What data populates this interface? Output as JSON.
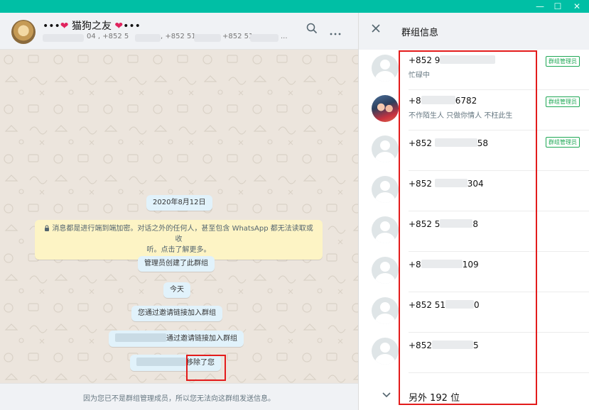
{
  "window": {
    "minimize": "—",
    "maximize": "☐",
    "close": "✕"
  },
  "chat": {
    "title_left": "•••",
    "heart": "❤",
    "title_name": "猫狗之友",
    "title_right": "•••",
    "subtitle_parts": [
      "04 , +852 5",
      ", +852 51",
      "+852 51",
      "..."
    ],
    "date_chip": "2020年8月12日",
    "encryption_notice_line1": "消息都是进行端到端加密。对话之外的任何人，甚至包含 WhatsApp 都无法读取或收",
    "encryption_notice_line2": "听。点击了解更多。",
    "admin_created": "管理员创建了此群组",
    "today_chip": "今天",
    "joined_via_link": "您通过邀请链接加入群组",
    "other_joined": "通过邀请链接加入群组",
    "removed_prefix": "",
    "removed_you": "移除了您",
    "footer_notice": "因为您已不是群组管理成员，所以您无法向这群组发送信息。"
  },
  "info": {
    "title": "群组信息",
    "admin_badge": "群组管理员",
    "members": [
      {
        "phone_prefix": "+852 9",
        "phone_suffix": "",
        "status": "忙碌中",
        "admin": true,
        "photo": false
      },
      {
        "phone_prefix": "+8",
        "phone_suffix": "6782",
        "status": "不作陌生人 只做你情人 不枉此生",
        "admin": true,
        "photo": true
      },
      {
        "phone_prefix": "+852 ",
        "phone_suffix": "58",
        "status": "",
        "admin": true,
        "photo": false
      },
      {
        "phone_prefix": "+852 ",
        "phone_suffix": "304",
        "status": "",
        "admin": false,
        "photo": false
      },
      {
        "phone_prefix": "+852 5",
        "phone_suffix": "8",
        "status": "",
        "admin": false,
        "photo": false
      },
      {
        "phone_prefix": "+8",
        "phone_suffix": "109",
        "status": "",
        "admin": false,
        "photo": false
      },
      {
        "phone_prefix": "+852 51",
        "phone_suffix": "0",
        "status": "",
        "admin": false,
        "photo": false
      },
      {
        "phone_prefix": "+852",
        "phone_suffix": "5",
        "status": "",
        "admin": false,
        "photo": false
      }
    ],
    "more_label": "另外 192 位"
  },
  "colors": {
    "accent": "#00bfa5",
    "admin_green": "#1fa855",
    "highlight_red": "#e31b1b",
    "notice_yellow": "#fdf4c5",
    "system_bubble": "#e1f2fb"
  },
  "icons": {
    "search": "search-icon",
    "menu": "more-vertical-icon",
    "close": "close-icon",
    "chevron": "chevron-down-icon",
    "lock": "lock-icon"
  }
}
